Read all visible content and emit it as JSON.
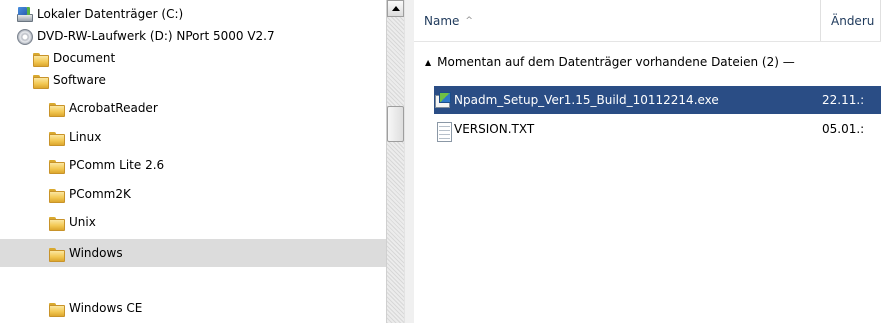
{
  "nav_tree": {
    "items": [
      {
        "label": "Lokaler Datenträger (C:)",
        "icon": "drive-icon",
        "indent": 0,
        "selected": false
      },
      {
        "label": "DVD-RW-Laufwerk (D:) NPort 5000 V2.7",
        "icon": "dvd-icon",
        "indent": 0,
        "selected": false
      },
      {
        "label": "Document",
        "icon": "folder-icon",
        "indent": 1,
        "selected": false
      },
      {
        "label": "Software",
        "icon": "folder-icon",
        "indent": 1,
        "selected": false
      },
      {
        "label": "AcrobatReader",
        "icon": "folder-icon",
        "indent": 2,
        "selected": false
      },
      {
        "label": "Linux",
        "icon": "folder-icon",
        "indent": 2,
        "selected": false
      },
      {
        "label": "PComm Lite 2.6",
        "icon": "folder-icon",
        "indent": 2,
        "selected": false
      },
      {
        "label": "PComm2K",
        "icon": "folder-icon",
        "indent": 2,
        "selected": false
      },
      {
        "label": "Unix",
        "icon": "folder-icon",
        "indent": 2,
        "selected": false
      },
      {
        "label": "Windows",
        "icon": "folder-icon",
        "indent": 2,
        "selected": true
      },
      {
        "label": "Windows CE",
        "icon": "folder-icon",
        "indent": 2,
        "selected": false
      }
    ]
  },
  "file_list": {
    "columns": [
      {
        "label": "Name",
        "sort_indicator": "^"
      },
      {
        "label": "Änderu"
      }
    ],
    "group_header": "Momentan auf dem Datenträger vorhandene Dateien (2) —",
    "files": [
      {
        "name": "Npadm_Setup_Ver1.15_Build_10112214.exe",
        "date": "22.11.:",
        "icon": "exe-icon",
        "selected": true
      },
      {
        "name": "VERSION.TXT",
        "date": "05.01.:",
        "icon": "txt-icon",
        "selected": false
      }
    ]
  },
  "colors": {
    "selection_blue": "#2a4d85",
    "tree_selection_gray": "#dcdcdc",
    "header_text": "#1e395b"
  }
}
